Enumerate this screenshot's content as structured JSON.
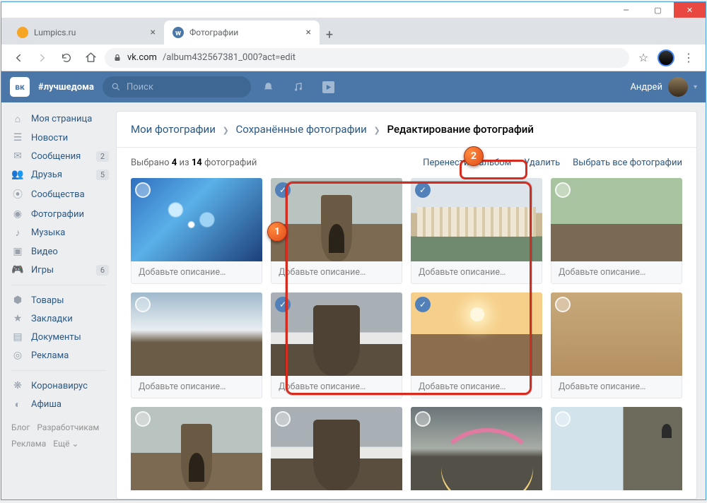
{
  "window": {
    "tabs": [
      {
        "title": "Lumpics.ru",
        "active": false
      },
      {
        "title": "Фотографии",
        "active": true
      }
    ],
    "url_domain": "vk.com",
    "url_path": "/album432567381_000?act=edit"
  },
  "vk_header": {
    "logo": "вк",
    "hashtag": "#лучшедома",
    "search_placeholder": "Поиск",
    "username": "Андрей"
  },
  "sidebar": {
    "items": [
      {
        "icon": "home-icon",
        "label": "Моя страница"
      },
      {
        "icon": "news-icon",
        "label": "Новости"
      },
      {
        "icon": "messages-icon",
        "label": "Сообщения",
        "badge": "2"
      },
      {
        "icon": "friends-icon",
        "label": "Друзья",
        "badge": "5"
      },
      {
        "icon": "groups-icon",
        "label": "Сообщества"
      },
      {
        "icon": "photos-icon",
        "label": "Фотографии"
      },
      {
        "icon": "music-icon",
        "label": "Музыка"
      },
      {
        "icon": "video-icon",
        "label": "Видео"
      },
      {
        "icon": "games-icon",
        "label": "Игры",
        "badge": "6"
      }
    ],
    "items2": [
      {
        "icon": "market-icon",
        "label": "Товары"
      },
      {
        "icon": "bookmarks-icon",
        "label": "Закладки"
      },
      {
        "icon": "docs-icon",
        "label": "Документы"
      },
      {
        "icon": "ads-icon",
        "label": "Реклама"
      }
    ],
    "items3": [
      {
        "icon": "covid-icon",
        "label": "Коронавирус"
      },
      {
        "icon": "events-icon",
        "label": "Афиша"
      }
    ],
    "footer": {
      "l1a": "Блог",
      "l1b": "Разработчикам",
      "l2a": "Реклама",
      "l2b": "Ещё ⌄"
    }
  },
  "breadcrumbs": {
    "a": "Мои фотографии",
    "b": "Сохранённые фотографии",
    "c": "Редактирование фотографий"
  },
  "actionbar": {
    "prefix": "Выбрано ",
    "selected": "4",
    "mid": " из ",
    "total": "14",
    "suffix": " фотографий",
    "move": "Перенести в альбом",
    "delete": "Удалить",
    "select_all": "Выбрать все фотографии"
  },
  "caption_placeholder": "Добавьте описание…",
  "photos": [
    {
      "selected": false,
      "cls": "t0",
      "caption": true
    },
    {
      "selected": true,
      "cls": "t-ronda",
      "caption": true
    },
    {
      "selected": true,
      "cls": "t-city",
      "caption": true
    },
    {
      "selected": false,
      "cls": "t-green",
      "caption": true
    },
    {
      "selected": false,
      "cls": "t-cloud",
      "caption": true
    },
    {
      "selected": true,
      "cls": "t-fog",
      "caption": true
    },
    {
      "selected": true,
      "cls": "t-sun",
      "caption": true
    },
    {
      "selected": false,
      "cls": "t-house",
      "caption": true
    },
    {
      "selected": false,
      "cls": "t-ronda",
      "caption": false
    },
    {
      "selected": false,
      "cls": "t-fog",
      "caption": false
    },
    {
      "selected": false,
      "cls": "t-rainbow",
      "caption": false
    },
    {
      "selected": false,
      "cls": "t-cliff",
      "caption": false
    }
  ],
  "annotations": {
    "n1": "1",
    "n2": "2"
  }
}
